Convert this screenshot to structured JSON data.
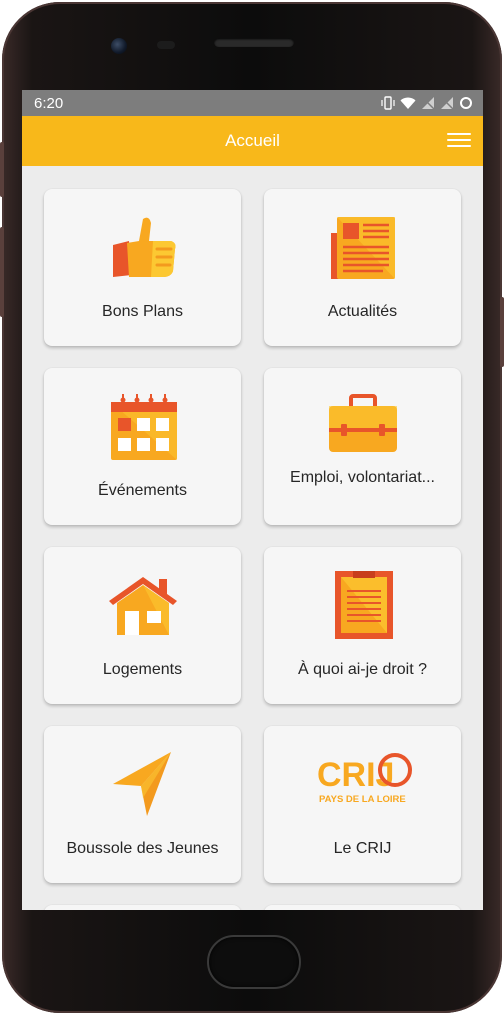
{
  "statusbar": {
    "time": "6:20"
  },
  "appbar": {
    "title": "Accueil"
  },
  "tiles": [
    {
      "label": "Bons Plans",
      "icon": "thumbs-up-icon"
    },
    {
      "label": "Actualités",
      "icon": "newspaper-icon"
    },
    {
      "label": "Événements",
      "icon": "calendar-icon"
    },
    {
      "label": "Emploi, volontariat...",
      "icon": "briefcase-icon"
    },
    {
      "label": "Logements",
      "icon": "house-icon"
    },
    {
      "label": "À quoi ai-je droit ?",
      "icon": "clipboard-icon"
    },
    {
      "label": "Boussole des Jeunes",
      "icon": "navigation-arrow-icon"
    },
    {
      "label": "Le CRIJ",
      "icon": "crij-logo",
      "logo_text": "CRIJ",
      "logo_subtext": "PAYS DE LA LOIRE"
    }
  ],
  "colors": {
    "accent": "#f8b81a",
    "orange": "#f39a1e",
    "red": "#e8552a",
    "yellow": "#fcc832",
    "statusbar": "#7d7d7d"
  }
}
